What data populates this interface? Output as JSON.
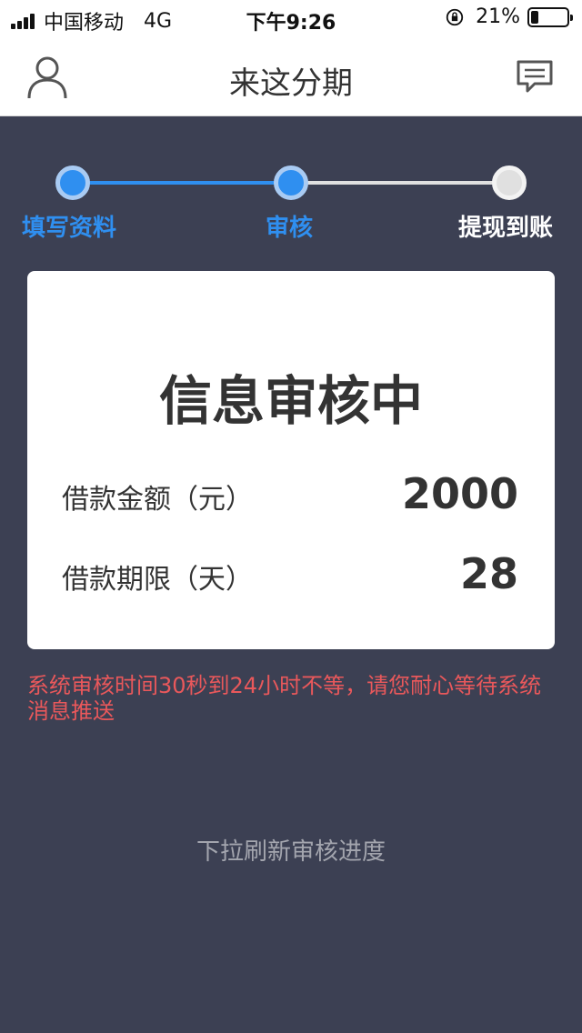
{
  "status_bar": {
    "carrier": "中国移动",
    "network": "4G",
    "time": "下午9:26",
    "battery_percent": "21%",
    "battery_level": 0.21
  },
  "nav": {
    "title": "来这分期",
    "left_icon": "user-icon",
    "right_icon": "message-icon"
  },
  "steps": {
    "items": [
      {
        "label": "填写资料",
        "active": true
      },
      {
        "label": "审核",
        "active": true
      },
      {
        "label": "提现到账",
        "active": false
      }
    ],
    "colors": {
      "active": "#2f8ff0",
      "inactive_label": "#ffffff",
      "inactive_line": "#e0e0e0"
    }
  },
  "card": {
    "heading": "信息审核中",
    "rows": [
      {
        "label": "借款金额（元）",
        "value": "2000"
      },
      {
        "label": "借款期限（天）",
        "value": "28"
      }
    ]
  },
  "notice": "系统审核时间30秒到24小时不等，请您耐心等待系统消息推送",
  "pull_hint": "下拉刷新审核进度",
  "colors": {
    "background": "#3c4053",
    "notice": "#e9585b"
  }
}
